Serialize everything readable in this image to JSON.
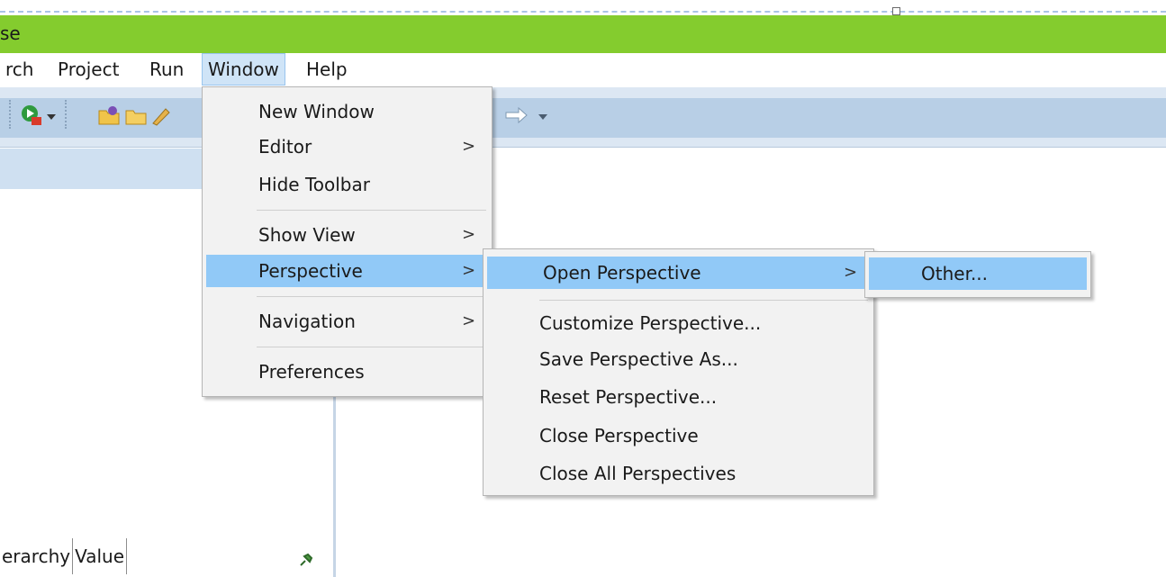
{
  "titlebar": {
    "title": "se"
  },
  "menubar": {
    "items": [
      {
        "label": "rch"
      },
      {
        "label": "Project"
      },
      {
        "label": "Run"
      },
      {
        "label": "Window"
      },
      {
        "label": "Help"
      }
    ]
  },
  "window_menu": {
    "items": [
      {
        "label": "New Window"
      },
      {
        "label": "Editor",
        "arrow": ">"
      },
      {
        "label": "Hide Toolbar"
      },
      {
        "label": "Show View",
        "arrow": ">"
      },
      {
        "label": "Perspective",
        "arrow": ">"
      },
      {
        "label": "Navigation",
        "arrow": ">"
      },
      {
        "label": "Preferences"
      }
    ]
  },
  "perspective_menu": {
    "items": [
      {
        "label": "Open Perspective",
        "arrow": ">"
      },
      {
        "label": "Customize Perspective..."
      },
      {
        "label": "Save Perspective As..."
      },
      {
        "label": "Reset Perspective..."
      },
      {
        "label": "Close Perspective"
      },
      {
        "label": "Close All Perspectives"
      }
    ]
  },
  "open_perspective_menu": {
    "items": [
      {
        "label": "Other..."
      }
    ]
  },
  "left_panel": {
    "columns": [
      {
        "label": "erarchy"
      },
      {
        "label": "Value"
      }
    ]
  },
  "colors": {
    "titlebar": "#84cc2e",
    "highlight": "#91c9f7",
    "menu_bg": "#f2f2f2"
  }
}
